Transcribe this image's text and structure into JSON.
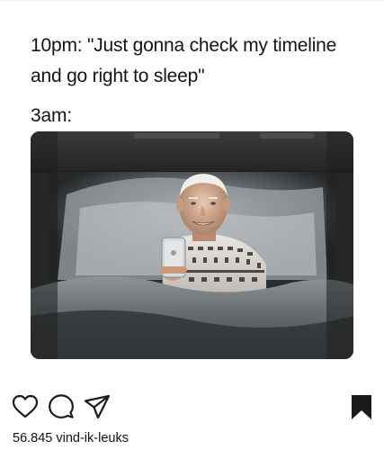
{
  "post": {
    "caption": {
      "line1": "10pm: \"Just gonna check my timeline",
      "line2": "and go right to sleep\"",
      "line3": "3am:"
    },
    "likes_text": "56.845 vind-ik-leuks"
  },
  "icons": {
    "like": "heart-icon",
    "comment": "comment-icon",
    "share": "send-icon",
    "save": "bookmark-icon"
  },
  "colors": {
    "text": "#111111",
    "icon": "#1a1a1a",
    "background": "#ffffff"
  }
}
